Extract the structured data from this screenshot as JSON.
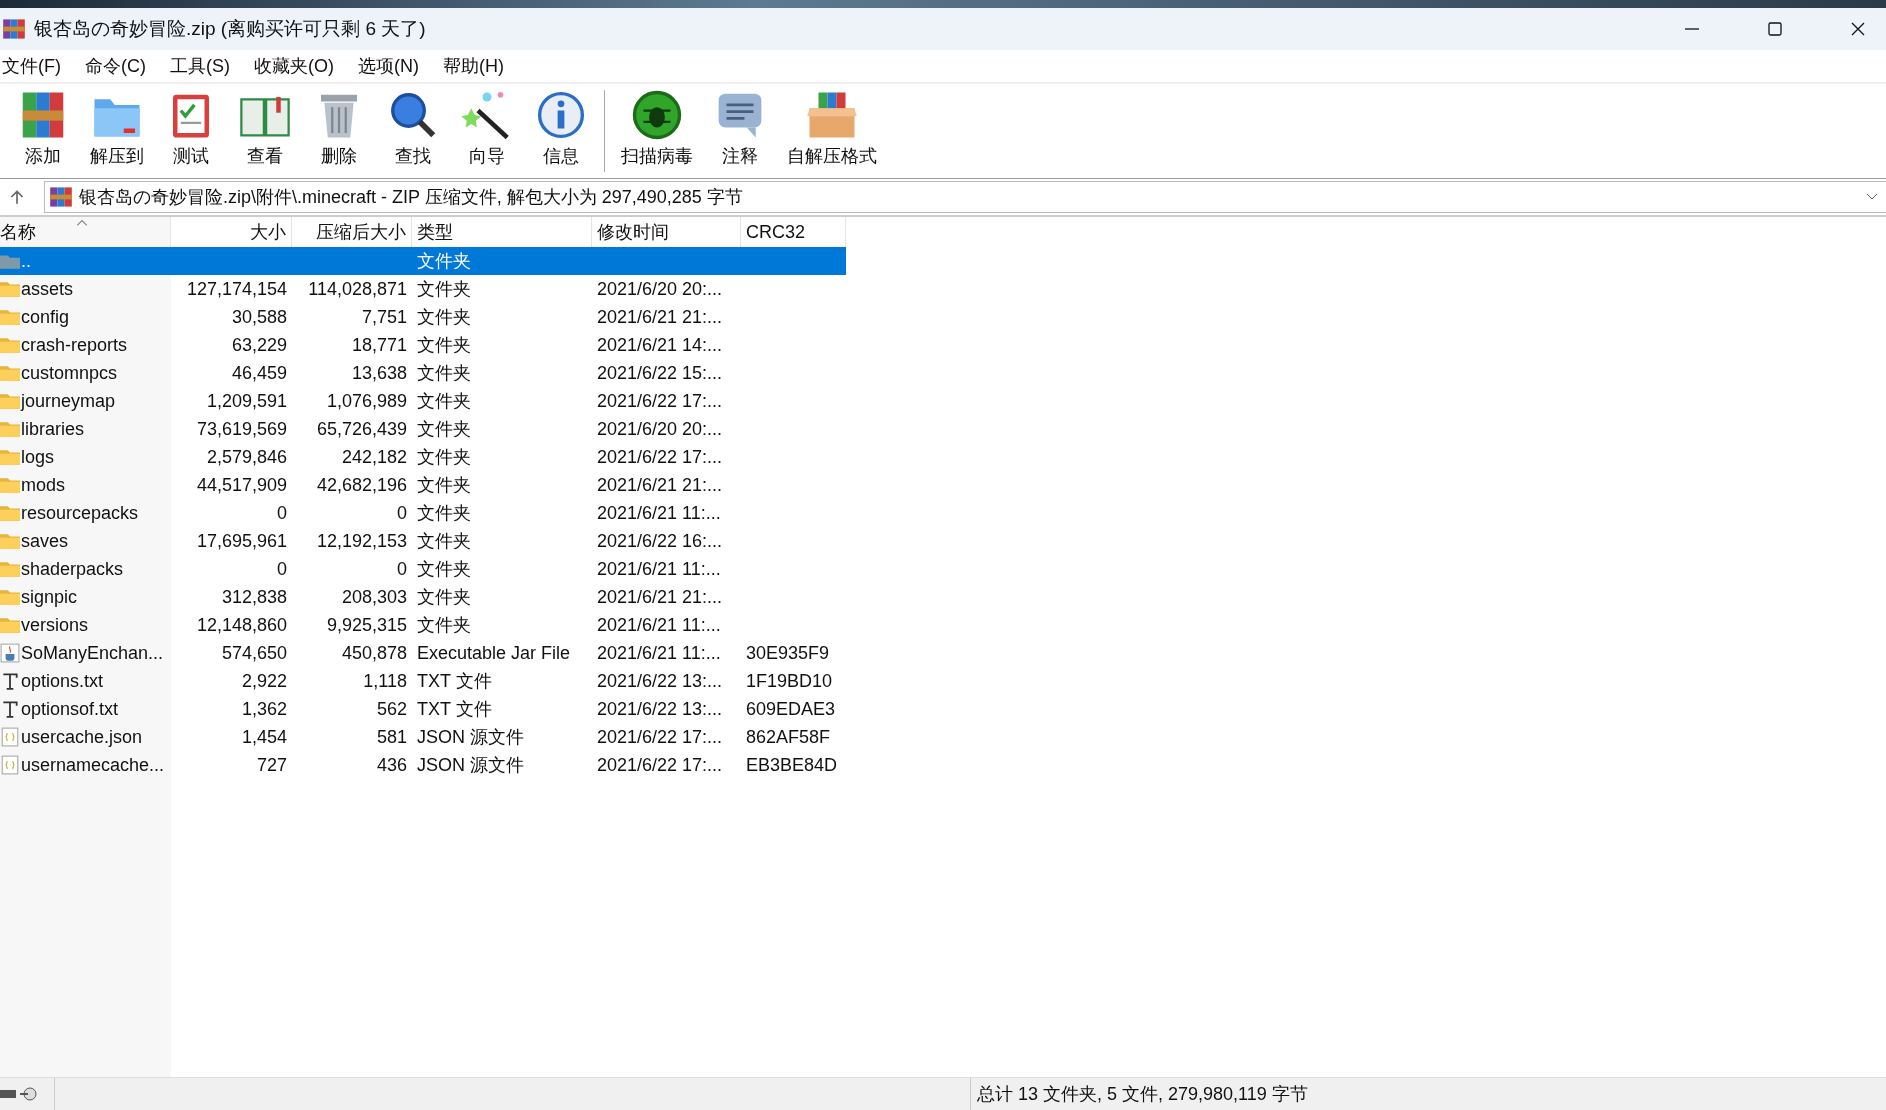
{
  "window": {
    "title": "银杏岛の奇妙冒险.zip (离购买许可只剩 6 天了)"
  },
  "menu": [
    "文件(F)",
    "命令(C)",
    "工具(S)",
    "收藏夹(O)",
    "选项(N)",
    "帮助(H)"
  ],
  "toolbar": [
    {
      "kind": "add",
      "label": "添加"
    },
    {
      "kind": "extract",
      "label": "解压到"
    },
    {
      "kind": "test",
      "label": "测试"
    },
    {
      "kind": "view",
      "label": "查看"
    },
    {
      "kind": "delete",
      "label": "删除"
    },
    {
      "kind": "find",
      "label": "查找"
    },
    {
      "kind": "wizard",
      "label": "向导"
    },
    {
      "kind": "info",
      "label": "信息"
    },
    {
      "kind": "virus",
      "label": "扫描病毒"
    },
    {
      "kind": "comment",
      "label": "注释"
    },
    {
      "kind": "sfx",
      "label": "自解压格式"
    }
  ],
  "address": {
    "path": "银杏岛の奇妙冒险.zip\\附件\\.minecraft - ZIP 压缩文件, 解包大小为 297,490,285 字节"
  },
  "table": {
    "columns": [
      "名称",
      "大小",
      "压缩后大小",
      "类型",
      "修改时间",
      "CRC32"
    ],
    "rows": [
      {
        "kind": "up",
        "name": "..",
        "size": "",
        "packed": "",
        "type": "文件夹",
        "modified": "",
        "crc": "",
        "selected": true
      },
      {
        "kind": "folder",
        "name": "assets",
        "size": "127,174,154",
        "packed": "114,028,871",
        "type": "文件夹",
        "modified": "2021/6/20 20:...",
        "crc": "",
        "selected": false
      },
      {
        "kind": "folder",
        "name": "config",
        "size": "30,588",
        "packed": "7,751",
        "type": "文件夹",
        "modified": "2021/6/21 21:...",
        "crc": "",
        "selected": false
      },
      {
        "kind": "folder",
        "name": "crash-reports",
        "size": "63,229",
        "packed": "18,771",
        "type": "文件夹",
        "modified": "2021/6/21 14:...",
        "crc": "",
        "selected": false
      },
      {
        "kind": "folder",
        "name": "customnpcs",
        "size": "46,459",
        "packed": "13,638",
        "type": "文件夹",
        "modified": "2021/6/22 15:...",
        "crc": "",
        "selected": false
      },
      {
        "kind": "folder",
        "name": "journeymap",
        "size": "1,209,591",
        "packed": "1,076,989",
        "type": "文件夹",
        "modified": "2021/6/22 17:...",
        "crc": "",
        "selected": false
      },
      {
        "kind": "folder",
        "name": "libraries",
        "size": "73,619,569",
        "packed": "65,726,439",
        "type": "文件夹",
        "modified": "2021/6/20 20:...",
        "crc": "",
        "selected": false
      },
      {
        "kind": "folder",
        "name": "logs",
        "size": "2,579,846",
        "packed": "242,182",
        "type": "文件夹",
        "modified": "2021/6/22 17:...",
        "crc": "",
        "selected": false
      },
      {
        "kind": "folder",
        "name": "mods",
        "size": "44,517,909",
        "packed": "42,682,196",
        "type": "文件夹",
        "modified": "2021/6/21 21:...",
        "crc": "",
        "selected": false
      },
      {
        "kind": "folder",
        "name": "resourcepacks",
        "size": "0",
        "packed": "0",
        "type": "文件夹",
        "modified": "2021/6/21 11:...",
        "crc": "",
        "selected": false
      },
      {
        "kind": "folder",
        "name": "saves",
        "size": "17,695,961",
        "packed": "12,192,153",
        "type": "文件夹",
        "modified": "2021/6/22 16:...",
        "crc": "",
        "selected": false
      },
      {
        "kind": "folder",
        "name": "shaderpacks",
        "size": "0",
        "packed": "0",
        "type": "文件夹",
        "modified": "2021/6/21 11:...",
        "crc": "",
        "selected": false
      },
      {
        "kind": "folder",
        "name": "signpic",
        "size": "312,838",
        "packed": "208,303",
        "type": "文件夹",
        "modified": "2021/6/21 21:...",
        "crc": "",
        "selected": false
      },
      {
        "kind": "folder",
        "name": "versions",
        "size": "12,148,860",
        "packed": "9,925,315",
        "type": "文件夹",
        "modified": "2021/6/21 11:...",
        "crc": "",
        "selected": false
      },
      {
        "kind": "jar",
        "name": "SoManyEnchan...",
        "size": "574,650",
        "packed": "450,878",
        "type": "Executable Jar File",
        "modified": "2021/6/21 11:...",
        "crc": "30E935F9",
        "selected": false
      },
      {
        "kind": "txt",
        "name": "options.txt",
        "size": "2,922",
        "packed": "1,118",
        "type": "TXT 文件",
        "modified": "2021/6/22 13:...",
        "crc": "1F19BD10",
        "selected": false
      },
      {
        "kind": "txt",
        "name": "optionsof.txt",
        "size": "1,362",
        "packed": "562",
        "type": "TXT 文件",
        "modified": "2021/6/22 13:...",
        "crc": "609EDAE3",
        "selected": false
      },
      {
        "kind": "json",
        "name": "usercache.json",
        "size": "1,454",
        "packed": "581",
        "type": "JSON 源文件",
        "modified": "2021/6/22 17:...",
        "crc": "862AF58F",
        "selected": false
      },
      {
        "kind": "json",
        "name": "usernamecache...",
        "size": "727",
        "packed": "436",
        "type": "JSON 源文件",
        "modified": "2021/6/22 17:...",
        "crc": "EB3BE84D",
        "selected": false
      }
    ]
  },
  "status_bar": {
    "summary": "总计 13 文件夹, 5 文件, 279,980,119 字节"
  }
}
